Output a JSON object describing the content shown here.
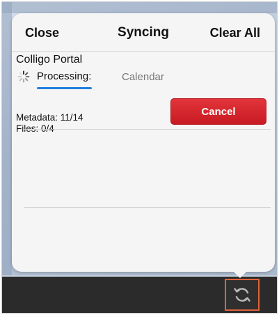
{
  "header": {
    "close_label": "Close",
    "title": "Syncing",
    "clear_all_label": "Clear All"
  },
  "item": {
    "title": "Colligo Portal",
    "status": "Processing:",
    "stage": "Calendar",
    "metadata": "Metadata: 11/14",
    "files": "Files: 0/4",
    "cancel_label": "Cancel"
  },
  "colors": {
    "cancel": "#d9252d",
    "progress": "#1f7fe0",
    "highlight": "#e0623a"
  },
  "icons": {
    "spinner": "activity-spinner-icon",
    "sync": "sync-icon"
  }
}
